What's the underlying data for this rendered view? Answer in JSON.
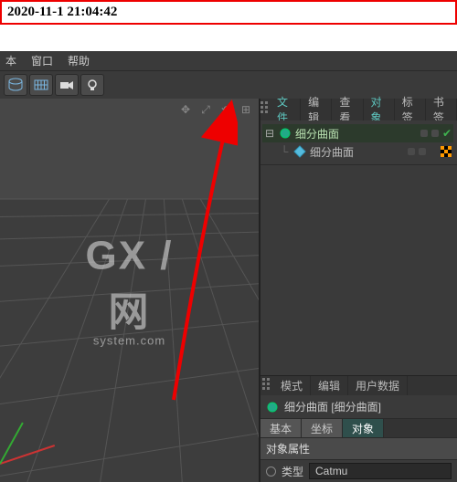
{
  "timestamp": "2020-11-1 21:04:42",
  "menu": {
    "item1": "本",
    "item2": "窗口",
    "item3": "帮助"
  },
  "watermark": {
    "line1": "GX / 网",
    "line2": "system.com"
  },
  "panel": {
    "tabs": {
      "file": "文件",
      "edit": "编辑",
      "view": "查看",
      "object": "对象",
      "tags": "标签",
      "bookmark": "书签"
    }
  },
  "tree": {
    "items": [
      {
        "label": "细分曲面"
      },
      {
        "label": "细分曲面"
      }
    ]
  },
  "attr": {
    "tabs": {
      "mode": "模式",
      "edit": "编辑",
      "userdata": "用户数据"
    },
    "title": "细分曲面 [细分曲面]",
    "mini": {
      "basic": "基本",
      "coord": "坐标",
      "object": "对象"
    },
    "section": "对象属性",
    "prop1_label": "类型",
    "prop1_value": "Catmu"
  }
}
